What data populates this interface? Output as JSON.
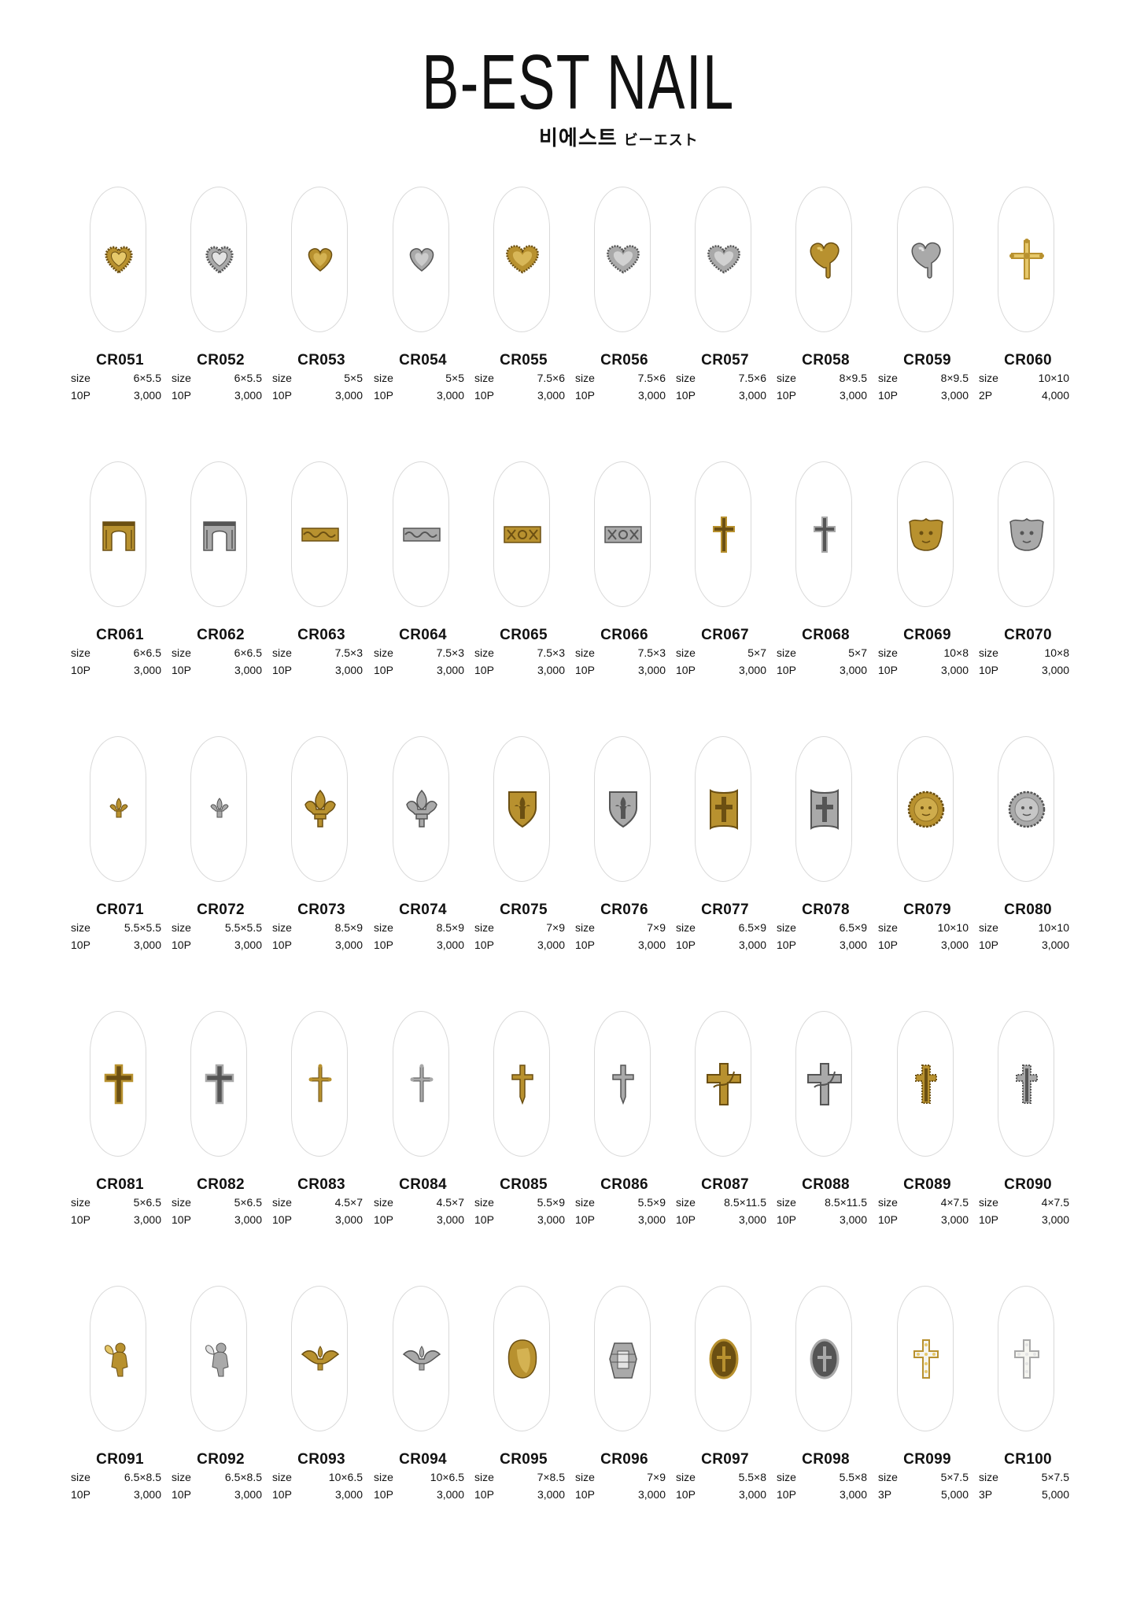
{
  "brand": {
    "logo_text": "B-EST NAIL",
    "korean": "비에스트",
    "japanese": "ビーエスト"
  },
  "colors": {
    "gold": "#b08a2e",
    "silver": "#a6a6a6",
    "outline": "#d9d9d9"
  },
  "size_label": "size",
  "products": [
    {
      "code": "CR051",
      "size": "6×5.5",
      "qty": "10P",
      "price": "3,000",
      "shape": "heart-beaded",
      "finish": "gold"
    },
    {
      "code": "CR052",
      "size": "6×5.5",
      "qty": "10P",
      "price": "3,000",
      "shape": "heart-beaded",
      "finish": "silver"
    },
    {
      "code": "CR053",
      "size": "5×5",
      "qty": "10P",
      "price": "3,000",
      "shape": "heart",
      "finish": "gold"
    },
    {
      "code": "CR054",
      "size": "5×5",
      "qty": "10P",
      "price": "3,000",
      "shape": "heart",
      "finish": "silver"
    },
    {
      "code": "CR055",
      "size": "7.5×6",
      "qty": "10P",
      "price": "3,000",
      "shape": "heart-wide",
      "finish": "gold"
    },
    {
      "code": "CR056",
      "size": "7.5×6",
      "qty": "10P",
      "price": "3,000",
      "shape": "heart-wide",
      "finish": "silver"
    },
    {
      "code": "CR057",
      "size": "7.5×6",
      "qty": "10P",
      "price": "3,000",
      "shape": "heart-wide",
      "finish": "silver"
    },
    {
      "code": "CR058",
      "size": "8×9.5",
      "qty": "10P",
      "price": "3,000",
      "shape": "heart-drip",
      "finish": "gold"
    },
    {
      "code": "CR059",
      "size": "8×9.5",
      "qty": "10P",
      "price": "3,000",
      "shape": "heart-drip",
      "finish": "silver"
    },
    {
      "code": "CR060",
      "size": "10×10",
      "qty": "2P",
      "price": "4,000",
      "shape": "cross-ornate",
      "finish": "gold"
    },
    {
      "code": "CR061",
      "size": "6×6.5",
      "qty": "10P",
      "price": "3,000",
      "shape": "arch",
      "finish": "gold"
    },
    {
      "code": "CR062",
      "size": "6×6.5",
      "qty": "10P",
      "price": "3,000",
      "shape": "arch",
      "finish": "silver"
    },
    {
      "code": "CR063",
      "size": "7.5×3",
      "qty": "10P",
      "price": "3,000",
      "shape": "bar-wave",
      "finish": "gold"
    },
    {
      "code": "CR064",
      "size": "7.5×3",
      "qty": "10P",
      "price": "3,000",
      "shape": "bar-wave",
      "finish": "silver"
    },
    {
      "code": "CR065",
      "size": "7.5×3",
      "qty": "10P",
      "price": "3,000",
      "shape": "bar-xox",
      "finish": "gold"
    },
    {
      "code": "CR066",
      "size": "7.5×3",
      "qty": "10P",
      "price": "3,000",
      "shape": "bar-xox",
      "finish": "silver"
    },
    {
      "code": "CR067",
      "size": "5×7",
      "qty": "10P",
      "price": "3,000",
      "shape": "cross-small",
      "finish": "gold"
    },
    {
      "code": "CR068",
      "size": "5×7",
      "qty": "10P",
      "price": "3,000",
      "shape": "cross-small",
      "finish": "silver"
    },
    {
      "code": "CR069",
      "size": "10×8",
      "qty": "10P",
      "price": "3,000",
      "shape": "medusa",
      "finish": "gold"
    },
    {
      "code": "CR070",
      "size": "10×8",
      "qty": "10P",
      "price": "3,000",
      "shape": "medusa",
      "finish": "silver"
    },
    {
      "code": "CR071",
      "size": "5.5×5.5",
      "qty": "10P",
      "price": "3,000",
      "shape": "fleur-small",
      "finish": "gold"
    },
    {
      "code": "CR072",
      "size": "5.5×5.5",
      "qty": "10P",
      "price": "3,000",
      "shape": "fleur-small",
      "finish": "silver"
    },
    {
      "code": "CR073",
      "size": "8.5×9",
      "qty": "10P",
      "price": "3,000",
      "shape": "fleur",
      "finish": "gold"
    },
    {
      "code": "CR074",
      "size": "8.5×9",
      "qty": "10P",
      "price": "3,000",
      "shape": "fleur",
      "finish": "silver"
    },
    {
      "code": "CR075",
      "size": "7×9",
      "qty": "10P",
      "price": "3,000",
      "shape": "shield",
      "finish": "gold"
    },
    {
      "code": "CR076",
      "size": "7×9",
      "qty": "10P",
      "price": "3,000",
      "shape": "shield",
      "finish": "silver"
    },
    {
      "code": "CR077",
      "size": "6.5×9",
      "qty": "10P",
      "price": "3,000",
      "shape": "plate-cross",
      "finish": "gold"
    },
    {
      "code": "CR078",
      "size": "6.5×9",
      "qty": "10P",
      "price": "3,000",
      "shape": "plate-cross",
      "finish": "silver"
    },
    {
      "code": "CR079",
      "size": "10×10",
      "qty": "10P",
      "price": "3,000",
      "shape": "coin",
      "finish": "gold"
    },
    {
      "code": "CR080",
      "size": "10×10",
      "qty": "10P",
      "price": "3,000",
      "shape": "coin",
      "finish": "silver"
    },
    {
      "code": "CR081",
      "size": "5×6.5",
      "qty": "10P",
      "price": "3,000",
      "shape": "cross-bold",
      "finish": "gold"
    },
    {
      "code": "CR082",
      "size": "5×6.5",
      "qty": "10P",
      "price": "3,000",
      "shape": "cross-bold",
      "finish": "silver"
    },
    {
      "code": "CR083",
      "size": "4.5×7",
      "qty": "10P",
      "price": "3,000",
      "shape": "cross-thin",
      "finish": "gold"
    },
    {
      "code": "CR084",
      "size": "4.5×7",
      "qty": "10P",
      "price": "3,000",
      "shape": "cross-thin",
      "finish": "silver"
    },
    {
      "code": "CR085",
      "size": "5.5×9",
      "qty": "10P",
      "price": "3,000",
      "shape": "sword-cross",
      "finish": "gold"
    },
    {
      "code": "CR086",
      "size": "5.5×9",
      "qty": "10P",
      "price": "3,000",
      "shape": "sword-cross",
      "finish": "silver"
    },
    {
      "code": "CR087",
      "size": "8.5×11.5",
      "qty": "10P",
      "price": "3,000",
      "shape": "cross-vine",
      "finish": "gold"
    },
    {
      "code": "CR088",
      "size": "8.5×11.5",
      "qty": "10P",
      "price": "3,000",
      "shape": "cross-vine",
      "finish": "silver"
    },
    {
      "code": "CR089",
      "size": "4×7.5",
      "qty": "10P",
      "price": "3,000",
      "shape": "cross-dotted",
      "finish": "gold"
    },
    {
      "code": "CR090",
      "size": "4×7.5",
      "qty": "10P",
      "price": "3,000",
      "shape": "cross-dotted",
      "finish": "silver"
    },
    {
      "code": "CR091",
      "size": "6.5×8.5",
      "qty": "10P",
      "price": "3,000",
      "shape": "cupid",
      "finish": "gold"
    },
    {
      "code": "CR092",
      "size": "6.5×8.5",
      "qty": "10P",
      "price": "3,000",
      "shape": "cupid",
      "finish": "silver"
    },
    {
      "code": "CR093",
      "size": "10×6.5",
      "qty": "10P",
      "price": "3,000",
      "shape": "winged-fleur",
      "finish": "gold"
    },
    {
      "code": "CR094",
      "size": "10×6.5",
      "qty": "10P",
      "price": "3,000",
      "shape": "winged-fleur",
      "finish": "silver"
    },
    {
      "code": "CR095",
      "size": "7×8.5",
      "qty": "10P",
      "price": "3,000",
      "shape": "face",
      "finish": "gold"
    },
    {
      "code": "CR096",
      "size": "7×9",
      "qty": "10P",
      "price": "3,000",
      "shape": "pharaoh",
      "finish": "silver"
    },
    {
      "code": "CR097",
      "size": "5.5×8",
      "qty": "10P",
      "price": "3,000",
      "shape": "oval-cross",
      "finish": "gold"
    },
    {
      "code": "CR098",
      "size": "5.5×8",
      "qty": "10P",
      "price": "3,000",
      "shape": "oval-cross",
      "finish": "silver"
    },
    {
      "code": "CR099",
      "size": "5×7.5",
      "qty": "3P",
      "price": "5,000",
      "shape": "cross-jewel",
      "finish": "gold"
    },
    {
      "code": "CR100",
      "size": "5×7.5",
      "qty": "3P",
      "price": "5,000",
      "shape": "cross-jewel",
      "finish": "silver"
    }
  ]
}
